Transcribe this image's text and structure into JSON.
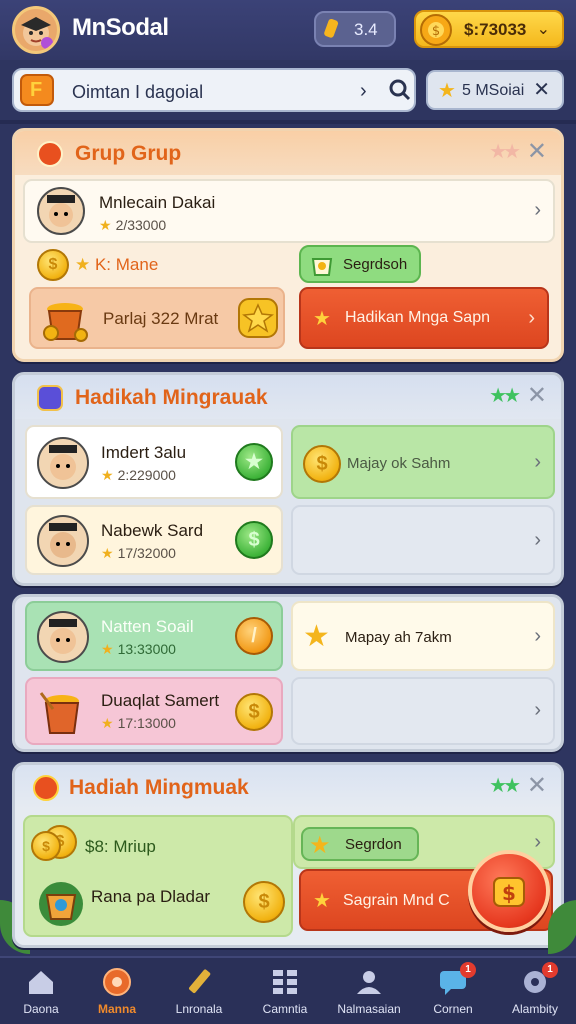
{
  "header": {
    "app_title": "MnSodal",
    "energy_value": "3.4",
    "coins_value": "$:73033",
    "coins_chevron": "⌄"
  },
  "search": {
    "text": "Oimtan I dagoial",
    "arrow": "›",
    "filter_label": "5 MSoiai",
    "filter_close": "✕"
  },
  "panel1": {
    "title": "Grup Grup",
    "stars": "★★",
    "close": "✕",
    "user_name": "Mnlecain Dakai",
    "user_score": "2/33000",
    "coin_label": "K: Mane",
    "badge_label": "Segrdsoh",
    "chest_label": "Parlaj 322 Mrat",
    "cta_label": "Hadikan Mnga Sapn",
    "chevron": "›"
  },
  "panel2": {
    "title": "Hadikah Mingrauak",
    "stars": "★★",
    "close": "✕",
    "rows": [
      {
        "name": "Imdert 3alu",
        "score": "2:229000"
      },
      {
        "name": "Nabewk Sard",
        "score": "17/32000"
      }
    ],
    "reward_label": "Majay ok Sahm",
    "chevron": "›"
  },
  "panel3": {
    "rows": [
      {
        "name": "Natten Soail",
        "score": "13:33000"
      },
      {
        "name": "Duaqlat Samert",
        "score": "17:13000"
      }
    ],
    "reward_label": "Mapay ah 7akm",
    "chevron": "›"
  },
  "panel4": {
    "title": "Hadiah Mingmuak",
    "stars": "★★",
    "close": "✕",
    "coins_label": "$8: Mriup",
    "badge_label": "Segrdon",
    "chest_label": "Rana pa Dladar",
    "cta_label": "Sagrain Mnd C",
    "chevron": "›"
  },
  "nav": [
    {
      "label": "Daona",
      "active": false
    },
    {
      "label": "Manna",
      "active": true
    },
    {
      "label": "Lnronala",
      "active": false
    },
    {
      "label": "Camntia",
      "active": false
    },
    {
      "label": "Nalmasaian",
      "active": false
    },
    {
      "label": "Cornen",
      "active": false,
      "badge": "1"
    },
    {
      "label": "Alambity",
      "active": false,
      "badge": "1"
    }
  ],
  "colors": {
    "background": "#2e3560",
    "accent_orange": "#e1641a",
    "cta_red": "#e8502a",
    "success_green": "#46b04a",
    "coin_gold": "#f2b312"
  }
}
